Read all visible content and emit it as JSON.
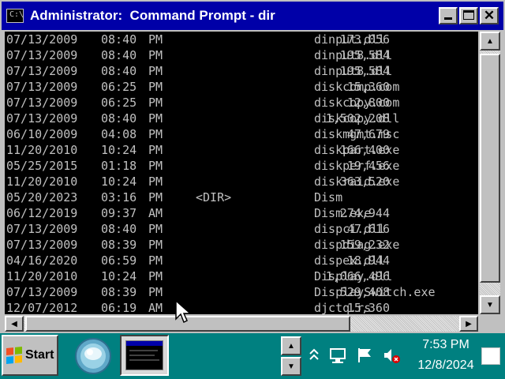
{
  "window": {
    "title": "Administrator:  Command Prompt - dir",
    "icon": "cmd-icon",
    "buttons": {
      "minimize": "minimize-icon",
      "maximize": "maximize-icon",
      "close_glyph": "✕"
    }
  },
  "console": {
    "rows": [
      {
        "date": "07/13/2009",
        "time": "08:40",
        "ampm": "PM",
        "size": "173,056",
        "name": "dinput.dll"
      },
      {
        "date": "07/13/2009",
        "time": "08:40",
        "ampm": "PM",
        "size": "195,584",
        "name": "dinput8.dll"
      },
      {
        "date": "07/13/2009",
        "time": "08:40",
        "ampm": "PM",
        "size": "195,584",
        "name": "dinput8.dll"
      },
      {
        "date": "07/13/2009",
        "time": "06:25",
        "ampm": "PM",
        "size": "15,360",
        "name": "diskcomp.com"
      },
      {
        "date": "07/13/2009",
        "time": "06:25",
        "ampm": "PM",
        "size": "12,800",
        "name": "diskcopy.com"
      },
      {
        "date": "07/13/2009",
        "time": "08:40",
        "ampm": "PM",
        "size": "1,502,208",
        "name": "diskcopy.dll"
      },
      {
        "date": "06/10/2009",
        "time": "04:08",
        "ampm": "PM",
        "size": "47,679",
        "name": "diskmgmt.msc"
      },
      {
        "date": "11/20/2010",
        "time": "10:24",
        "ampm": "PM",
        "size": "166,400",
        "name": "diskpart.exe"
      },
      {
        "date": "05/25/2015",
        "time": "01:18",
        "ampm": "PM",
        "size": "19,456",
        "name": "diskperf.exe"
      },
      {
        "date": "11/20/2010",
        "time": "10:24",
        "ampm": "PM",
        "size": "363,520",
        "name": "diskraid.exe"
      },
      {
        "date": "05/20/2023",
        "time": "03:16",
        "ampm": "PM",
        "size": "<DIR>",
        "name": "Dism",
        "is_dir": true
      },
      {
        "date": "06/12/2019",
        "time": "09:37",
        "ampm": "AM",
        "size": "274,944",
        "name": "Dism.exe"
      },
      {
        "date": "07/13/2009",
        "time": "08:40",
        "ampm": "PM",
        "size": "47,616",
        "name": "dispci.dll"
      },
      {
        "date": "07/13/2009",
        "time": "08:39",
        "ampm": "PM",
        "size": "159,232",
        "name": "dispdiag.exe"
      },
      {
        "date": "04/16/2020",
        "time": "06:59",
        "ampm": "PM",
        "size": "18,944",
        "name": "dispex.dll"
      },
      {
        "date": "11/20/2010",
        "time": "10:24",
        "ampm": "PM",
        "size": "1,066,496",
        "name": "Display.dll"
      },
      {
        "date": "07/13/2009",
        "time": "08:39",
        "ampm": "PM",
        "size": "529,408",
        "name": "DisplaySwitch.exe"
      },
      {
        "date": "12/07/2012",
        "time": "06:19",
        "ampm": "AM",
        "size": "15,360",
        "name": "djctq.rs"
      }
    ]
  },
  "taskbar": {
    "start_label": "Start",
    "clock_time": "7:53 PM",
    "clock_date": "12/8/2024",
    "tray_icons": [
      "chevron-up-icon",
      "network-icon",
      "flag-icon",
      "speaker-muted-icon"
    ]
  },
  "colors": {
    "title_bg": "#0000a8",
    "console_bg": "#000000",
    "console_fg": "#c0c0c0",
    "taskbar_bg": "#008080",
    "desktop_bg": "#000080"
  }
}
